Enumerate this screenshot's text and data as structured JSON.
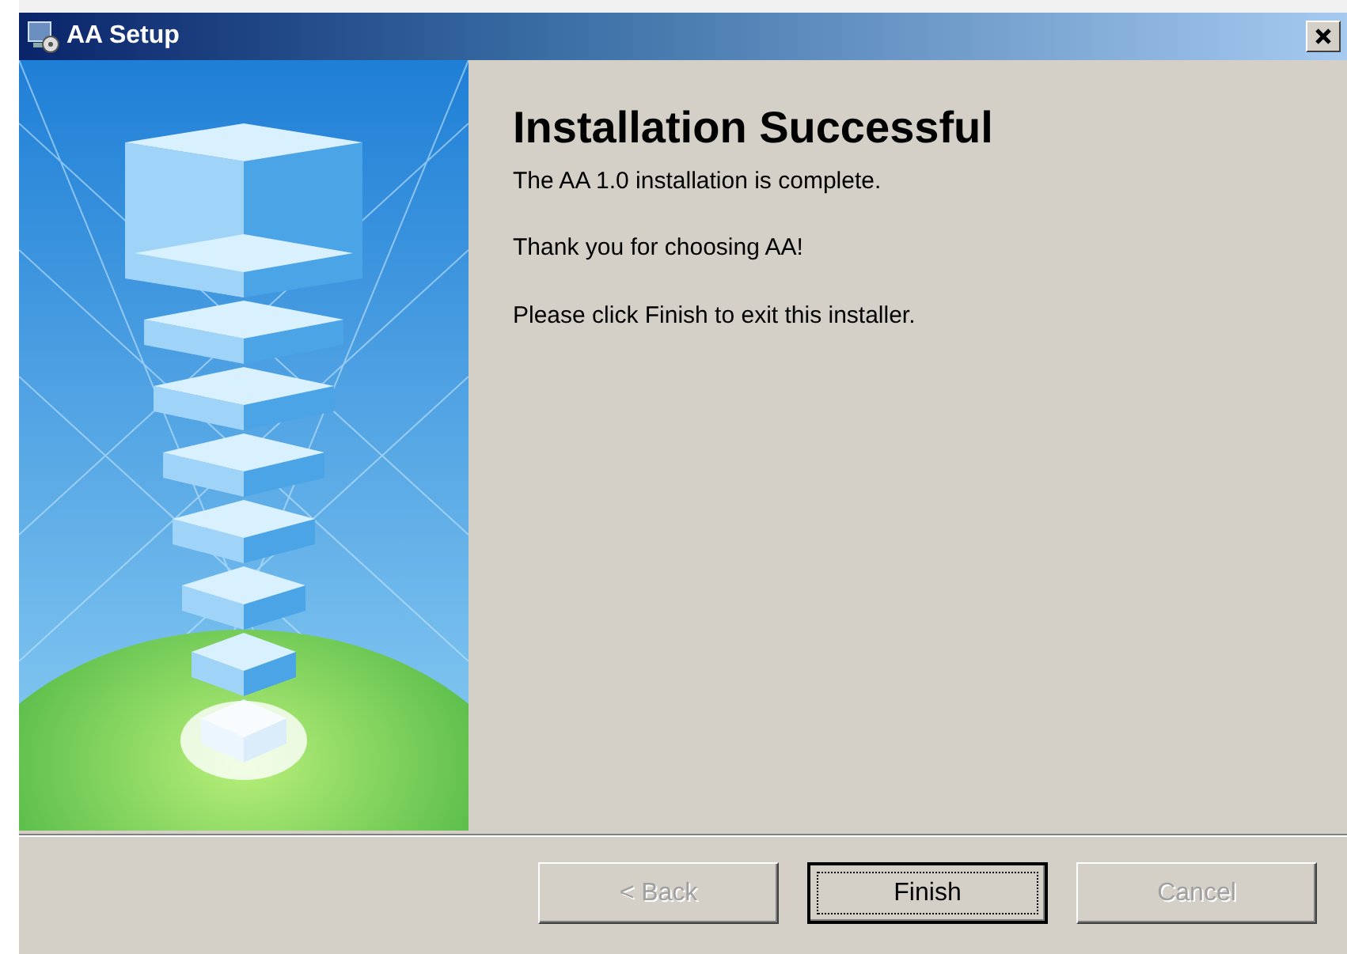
{
  "window": {
    "title": "AA Setup"
  },
  "heading": "Installation Successful",
  "paragraphs": [
    "The AA 1.0 installation is complete.",
    "Thank you for choosing AA!",
    "Please click Finish to exit this installer."
  ],
  "buttons": [
    {
      "label": "< Back",
      "disabled": true,
      "default": false
    },
    {
      "label": "Finish",
      "disabled": false,
      "default": true
    },
    {
      "label": "Cancel",
      "disabled": true,
      "default": false
    }
  ]
}
